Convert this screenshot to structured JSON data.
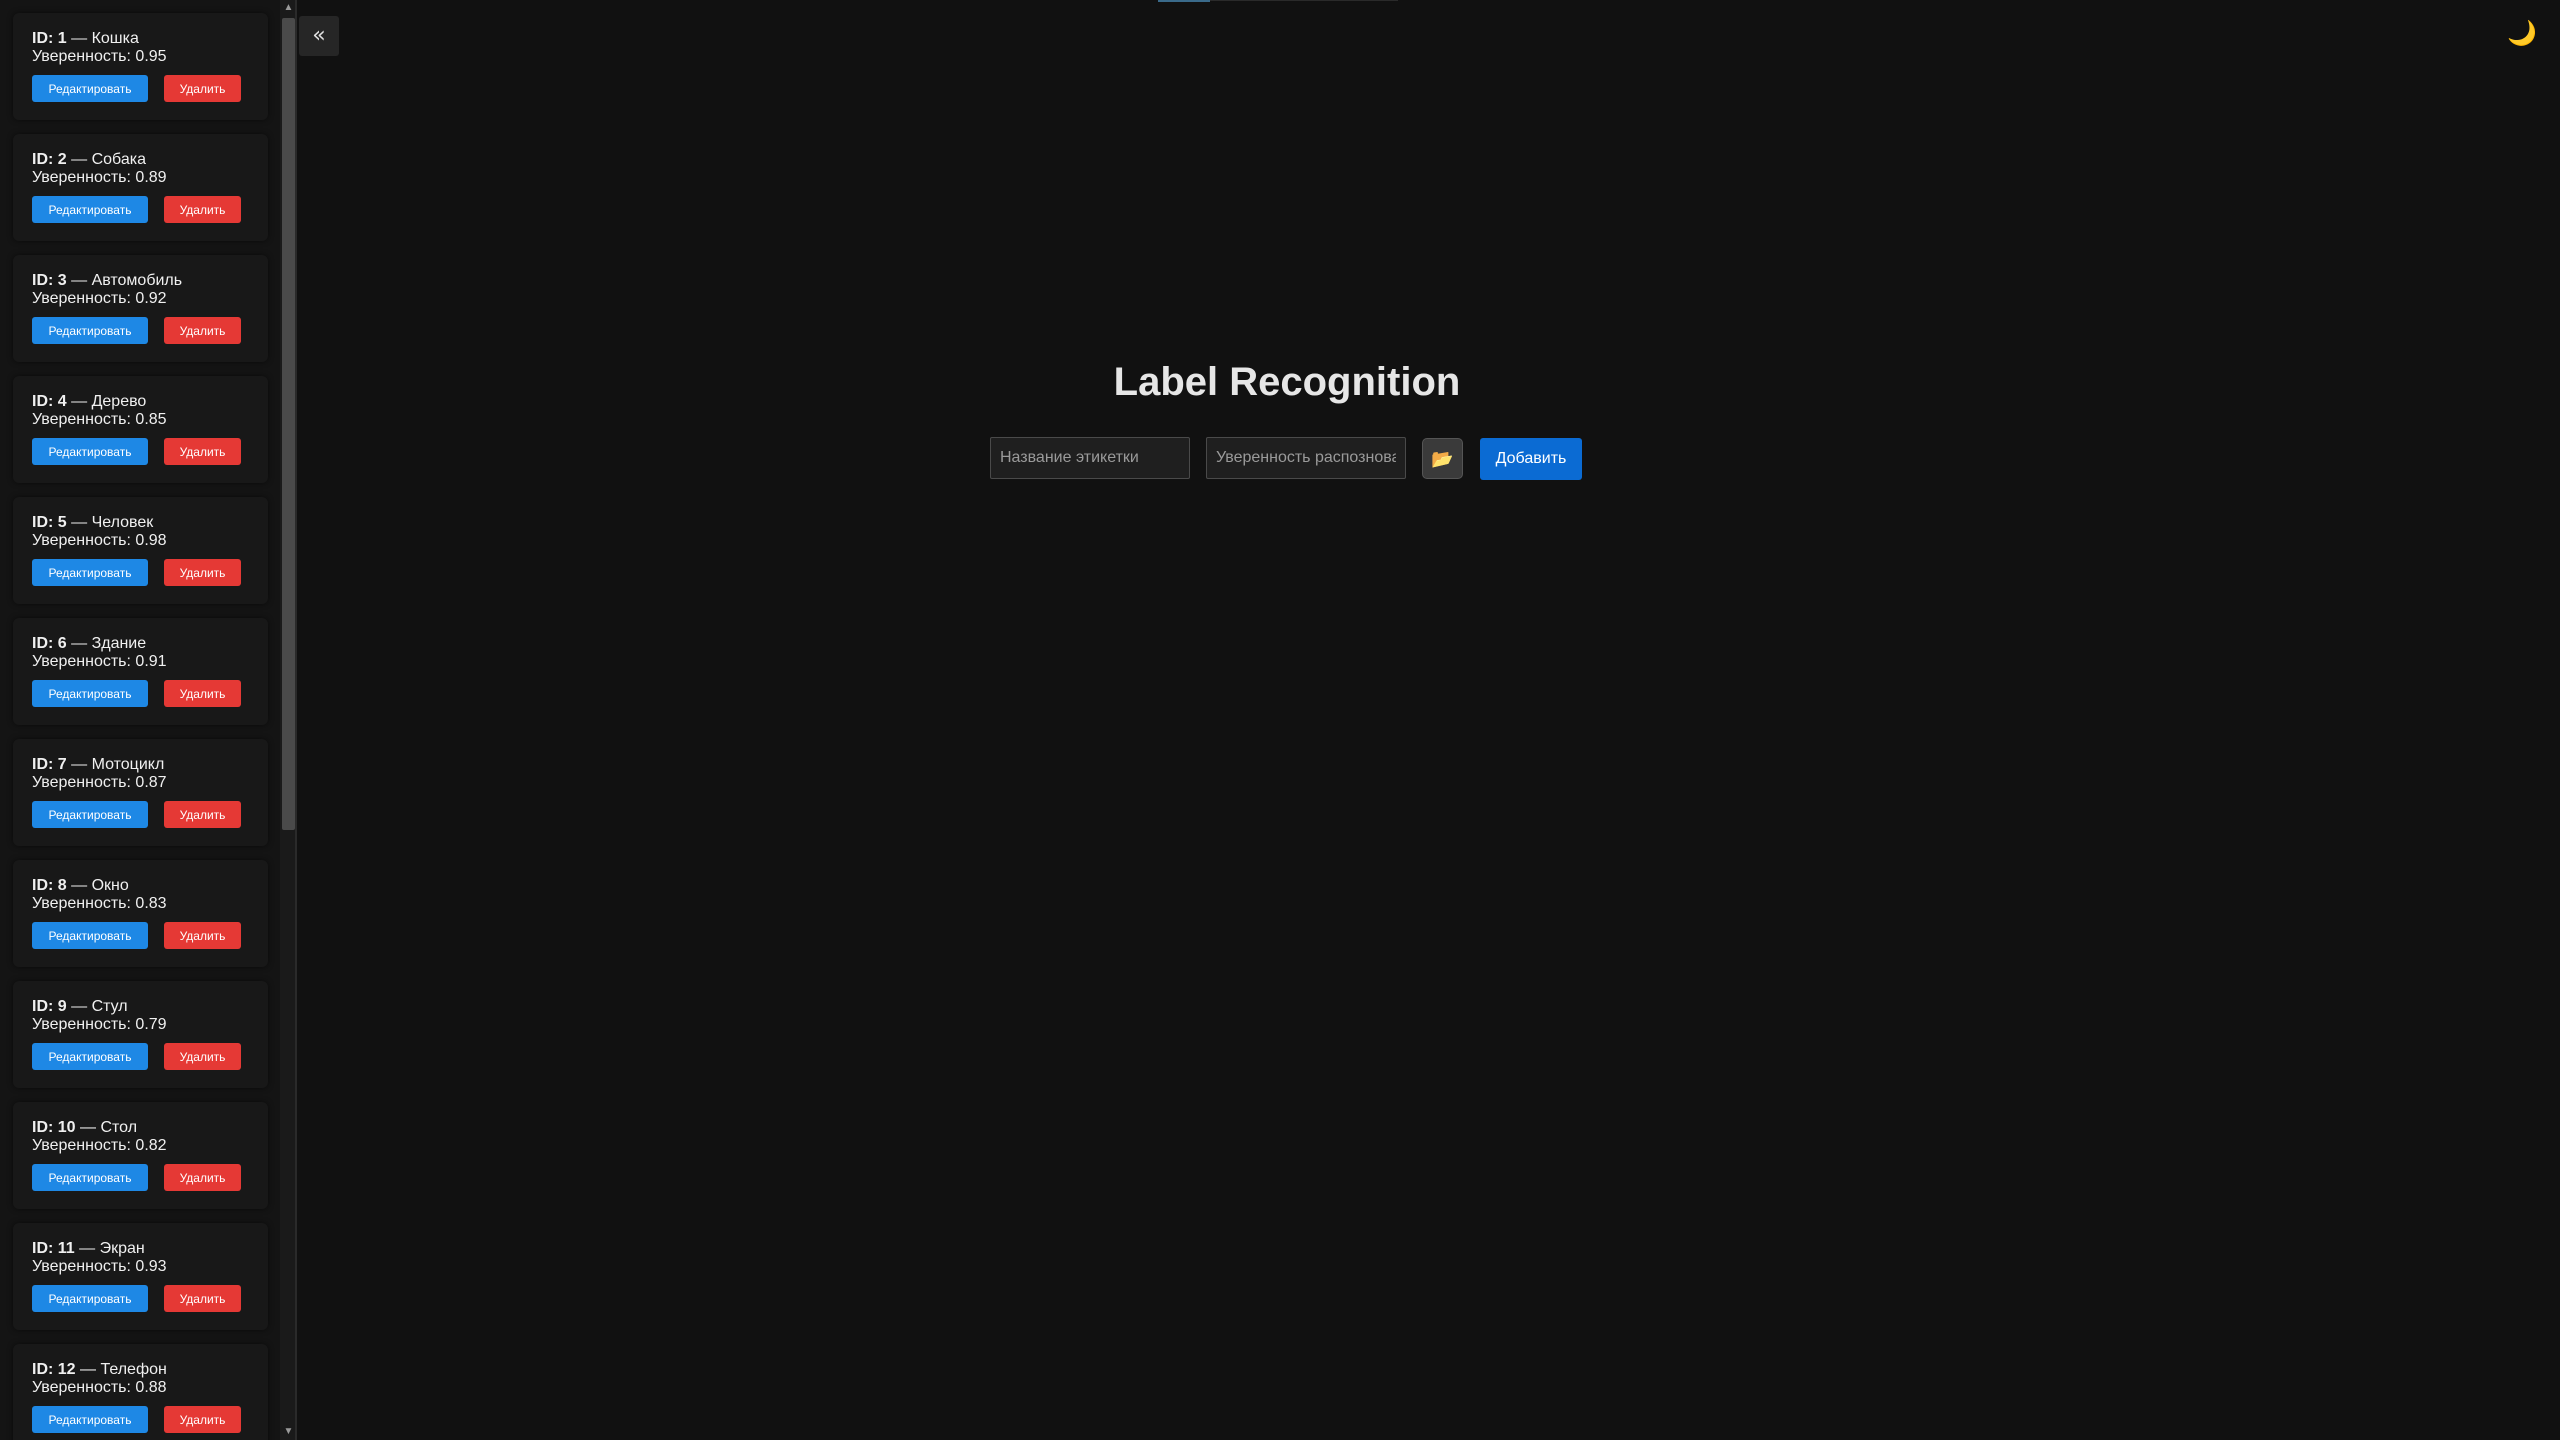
{
  "app": {
    "title": "Label Recognition"
  },
  "sidebar": {
    "edit_label": "Редактировать",
    "delete_label": "Удалить",
    "confidence_prefix": "Уверенность:",
    "items": [
      {
        "id_text": "ID: 1",
        "name": "Кошка",
        "confidence": "0.95"
      },
      {
        "id_text": "ID: 2",
        "name": "Собака",
        "confidence": "0.89"
      },
      {
        "id_text": "ID: 3",
        "name": "Автомобиль",
        "confidence": "0.92"
      },
      {
        "id_text": "ID: 4",
        "name": "Дерево",
        "confidence": "0.85"
      },
      {
        "id_text": "ID: 5",
        "name": "Человек",
        "confidence": "0.98"
      },
      {
        "id_text": "ID: 6",
        "name": "Здание",
        "confidence": "0.91"
      },
      {
        "id_text": "ID: 7",
        "name": "Мотоцикл",
        "confidence": "0.87"
      },
      {
        "id_text": "ID: 8",
        "name": "Окно",
        "confidence": "0.83"
      },
      {
        "id_text": "ID: 9",
        "name": "Стул",
        "confidence": "0.79"
      },
      {
        "id_text": "ID: 10",
        "name": "Стол",
        "confidence": "0.82"
      },
      {
        "id_text": "ID: 11",
        "name": "Экран",
        "confidence": "0.93"
      },
      {
        "id_text": "ID: 12",
        "name": "Телефон",
        "confidence": "0.88"
      }
    ]
  },
  "controls": {
    "collapse_icon": "«",
    "theme_icon": "🌙"
  },
  "form": {
    "name_placeholder": "Название этикетки",
    "confidence_placeholder": "Уверенность распознования",
    "file_icon": "📂",
    "add_label": "Добавить"
  },
  "colors": {
    "background": "#111111",
    "edit_button": "#1e88e5",
    "delete_button": "#e53935",
    "add_button": "#0b6bd3"
  }
}
